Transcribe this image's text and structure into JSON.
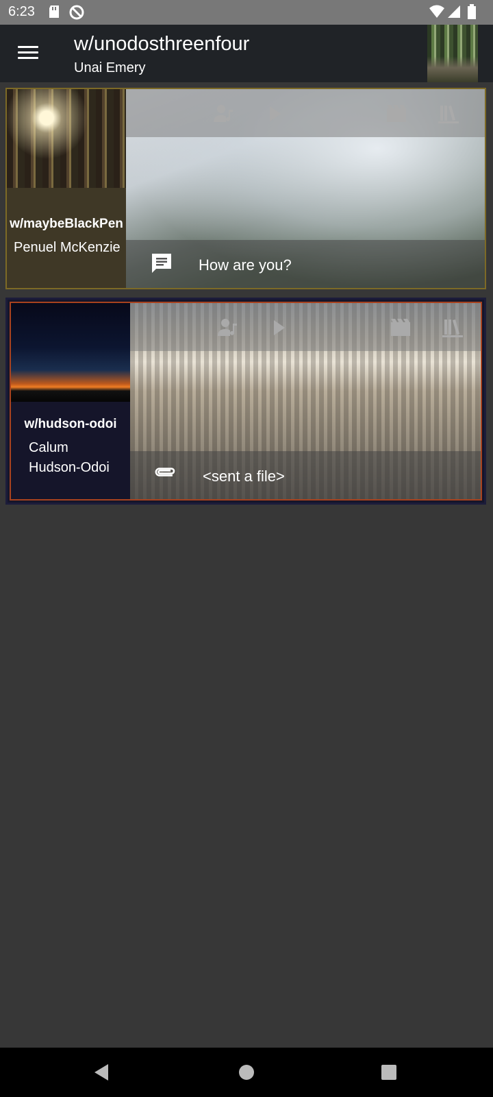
{
  "status_bar": {
    "time": "6:23",
    "icons": [
      "sd-card-icon",
      "do-not-disturb-icon",
      "wifi-icon",
      "signal-icon",
      "battery-icon"
    ]
  },
  "app_bar": {
    "title": "w/unodosthreenfour",
    "subtitle": "Unai Emery"
  },
  "conversations": [
    {
      "handle": "w/maybeBlackPen",
      "name": "Penuel McKenzie",
      "last_message": "How are you?",
      "message_icon": "message-icon",
      "accent": "#7d6a26"
    },
    {
      "handle": "w/hudson-odoi",
      "name_line1": "Calum",
      "name_line2": "Hudson-Odoi",
      "last_message": "<sent a file>",
      "message_icon": "attachment-icon",
      "accent": "#a8421e"
    }
  ],
  "card_toolbar_icons": [
    "music-person-icon",
    "play-icon",
    "movie-icon",
    "library-icon"
  ],
  "nav": [
    "back-icon",
    "home-icon",
    "recents-icon"
  ]
}
